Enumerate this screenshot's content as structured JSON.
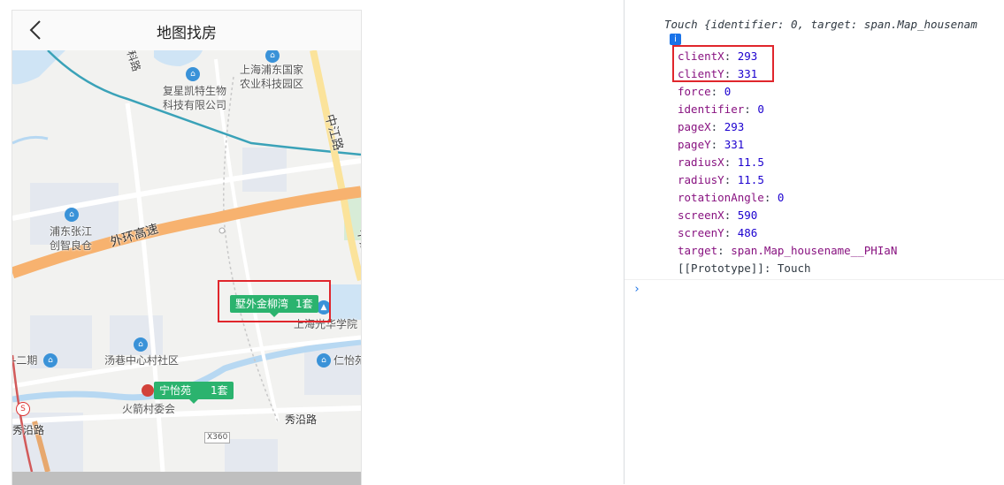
{
  "phone": {
    "title": "地图找房",
    "back_icon": "chevron-left-icon"
  },
  "map": {
    "roads": {
      "kelu": "科路",
      "zhongjiang_1": "中江路",
      "zhongjiang_2": "中江路",
      "waihuan": "外环高速",
      "xiuyan": "秀沿路",
      "xiuyan_left": "秀沿路",
      "x360": "X360"
    },
    "pois": {
      "fuxing": "复星凯特生物\n科技有限公司",
      "pudong_agri": "上海浦东国家\n农业科技园区",
      "zhangjiang": "浦东张江\n创智良仓",
      "guanghua": "上海光华学院",
      "tangxiang": "汤巷中心村社区",
      "er_qi": "-二期",
      "renyi": "仁怡苑",
      "huojian": "火箭村委会"
    },
    "markers": [
      {
        "name": "墅外金柳湾",
        "count": "1套"
      },
      {
        "name": "宁怡苑",
        "count": "1套"
      }
    ],
    "colors": {
      "marker": "#2bb36e",
      "highway": "#f7b26f",
      "metro": "#3aa2b8"
    }
  },
  "console": {
    "summary_type": "Touch",
    "summary_body": "{identifier: 0, target: span.Map_housenam",
    "info_badge": "i",
    "props": [
      {
        "key": "clientX",
        "value": "293"
      },
      {
        "key": "clientY",
        "value": "331"
      },
      {
        "key": "force",
        "value": "0"
      },
      {
        "key": "identifier",
        "value": "0"
      },
      {
        "key": "pageX",
        "value": "293"
      },
      {
        "key": "pageY",
        "value": "331"
      },
      {
        "key": "radiusX",
        "value": "11.5"
      },
      {
        "key": "radiusY",
        "value": "11.5"
      },
      {
        "key": "rotationAngle",
        "value": "0"
      },
      {
        "key": "screenX",
        "value": "590"
      },
      {
        "key": "screenY",
        "value": "486"
      }
    ],
    "target_key": "target",
    "target_value": "span.Map_housename__PHIaN",
    "proto_key": "[[Prototype]]",
    "proto_value": "Touch",
    "prompt": "›"
  }
}
